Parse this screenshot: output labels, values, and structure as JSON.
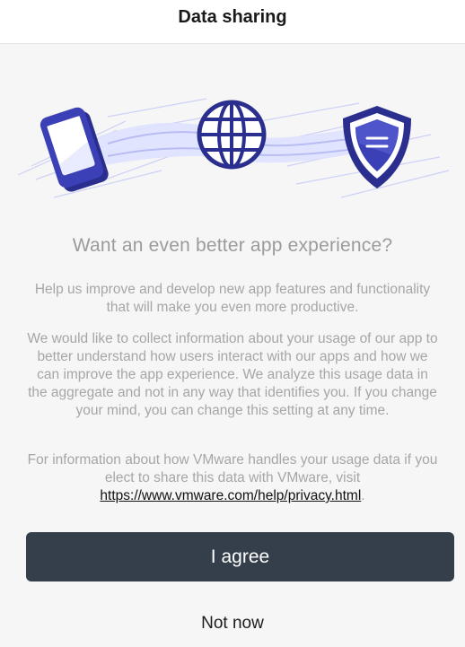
{
  "header": {
    "title": "Data sharing"
  },
  "illustration": {
    "icons": [
      "mobile-device-icon",
      "globe-icon",
      "shield-icon"
    ],
    "accent_color": "#3b40b6",
    "light_accent": "#dfe2ff"
  },
  "content": {
    "headline": "Want an even better app experience?",
    "paragraph1": "Help us improve and develop new app features and functionality that will make you even more productive.",
    "paragraph2": "We would like to collect information about your usage of our app to better understand how users interact with our apps and how we can improve the app experience. We analyze this usage data in the aggregate and not in any way that identifies you. If you change your mind, you can change this setting at any time.",
    "paragraph3_prefix": "For information about how VMware handles your usage data if you elect to share this data with VMware, visit ",
    "privacy_link": "https://www.vmware.com/help/privacy.html",
    "paragraph3_suffix": "."
  },
  "actions": {
    "agree_label": "I agree",
    "not_now_label": "Not now",
    "primary_color": "#343f4b"
  }
}
